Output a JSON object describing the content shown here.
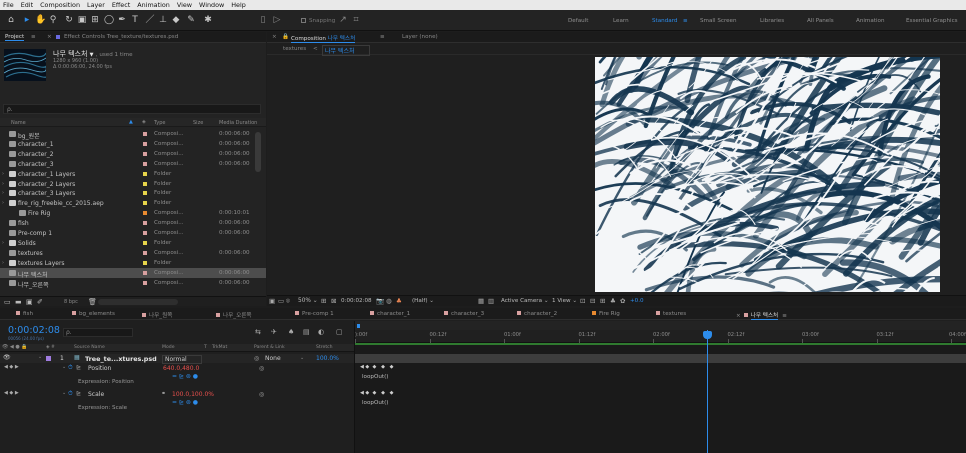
{
  "menubar": [
    "File",
    "Edit",
    "Composition",
    "Layer",
    "Effect",
    "Animation",
    "View",
    "Window",
    "Help"
  ],
  "toolbar": {
    "snapping": "Snapping",
    "workspaces": [
      "Default",
      "Learn",
      "Standard",
      "Small Screen",
      "Libraries",
      "All Panels",
      "Animation",
      "Essential Graphics"
    ],
    "active_workspace": "Standard"
  },
  "project": {
    "tab": "Project",
    "tab2": "Effect Controls Tree_texture/textures.psd",
    "comp_name": "나무 텍스처",
    "used": ", used 1 time",
    "size": "1280 x 960 (1.00)",
    "duration": "Δ 0:00:06:00, 24.00 fps",
    "search_placeholder": "ρ.",
    "columns": {
      "name": "Name",
      "type": "Type",
      "size": "Size",
      "media_duration": "Media Duration"
    },
    "items": [
      {
        "name": "bg_원본",
        "type": "Composi...",
        "duration": "0:00:06:00",
        "kind": "comp",
        "color": "#d8a0a0"
      },
      {
        "name": "character_1",
        "type": "Composi...",
        "duration": "0:00:06:00",
        "kind": "comp",
        "color": "#d8a0a0"
      },
      {
        "name": "character_2",
        "type": "Composi...",
        "duration": "0:00:06:00",
        "kind": "comp",
        "color": "#d8a0a0"
      },
      {
        "name": "character_3",
        "type": "Composi...",
        "duration": "0:00:06:00",
        "kind": "comp",
        "color": "#d8a0a0"
      },
      {
        "name": "character_1 Layers",
        "type": "Folder",
        "duration": "",
        "kind": "folder",
        "color": "#e6d44a"
      },
      {
        "name": "character_2 Layers",
        "type": "Folder",
        "duration": "",
        "kind": "folder",
        "color": "#e6d44a"
      },
      {
        "name": "character_3 Layers",
        "type": "Folder",
        "duration": "",
        "kind": "folder",
        "color": "#e6d44a"
      },
      {
        "name": "fire_rig_freebie_cc_2015.aep",
        "type": "Folder",
        "duration": "",
        "kind": "folder",
        "color": "#e6d44a"
      },
      {
        "name": "Fire Rig",
        "type": "Composi...",
        "duration": "0:00:10:01",
        "kind": "comp",
        "color": "#e88a30"
      },
      {
        "name": "fish",
        "type": "Composi...",
        "duration": "0:00:06:00",
        "kind": "comp",
        "color": "#d8a0a0"
      },
      {
        "name": "Pre-comp 1",
        "type": "Composi...",
        "duration": "0:00:06:00",
        "kind": "comp",
        "color": "#d8a0a0"
      },
      {
        "name": "Solids",
        "type": "Folder",
        "duration": "",
        "kind": "folder",
        "color": "#e6d44a"
      },
      {
        "name": "textures",
        "type": "Composi...",
        "duration": "0:00:06:00",
        "kind": "comp",
        "color": "#d8a0a0"
      },
      {
        "name": "textures Layers",
        "type": "Folder",
        "duration": "",
        "kind": "folder",
        "color": "#e6d44a"
      },
      {
        "name": "나무 텍스처",
        "type": "Composi...",
        "duration": "0:00:06:00",
        "kind": "comp",
        "color": "#d8a0a0"
      },
      {
        "name": "나무_오른쪽",
        "type": "Composi...",
        "duration": "0:00:06:00",
        "kind": "comp",
        "color": "#d8a0a0"
      }
    ],
    "bpc": "8 bpc"
  },
  "composition": {
    "tab": "Composition 나무 텍스처",
    "tab_comp": "나무 텍스처",
    "layer_tab": "Layer (none)",
    "breadcrumb": [
      "textures",
      "나무 텍스처"
    ],
    "zoom": "50%",
    "timecode": "0:00:02:08",
    "resolution": "(Half)",
    "camera": "Active Camera",
    "views": "1 View",
    "exposure": "+0.0"
  },
  "timeline": {
    "tabs": [
      {
        "label": "fish",
        "color": "#d8a0a0"
      },
      {
        "label": "bg_elements",
        "color": "#d8a0a0"
      },
      {
        "label": "나무_원쪽",
        "color": "#d8a0a0"
      },
      {
        "label": "나무_오른쪽",
        "color": "#d8a0a0"
      },
      {
        "label": "Pre-comp 1",
        "color": "#d8a0a0"
      },
      {
        "label": "character_1",
        "color": "#d8a0a0"
      },
      {
        "label": "character_3",
        "color": "#d8a0a0"
      },
      {
        "label": "character_2",
        "color": "#d8a0a0"
      },
      {
        "label": "Fire Rig",
        "color": "#e88a30"
      },
      {
        "label": "textures",
        "color": "#d8a0a0"
      },
      {
        "label": "나무 텍스처",
        "color": "#d8a0a0"
      }
    ],
    "timecode": "0:00:02:08",
    "timecode_sub": "00056 (24.00 fps)",
    "search_placeholder": "ρ.",
    "columns": {
      "source": "Source Name",
      "mode": "Mode",
      "t": "T",
      "trkmat": "TrkMat",
      "parent": "Parent & Link",
      "stretch": "Stretch"
    },
    "layer": {
      "index": "1",
      "name": "Tree_te...xtures.psd",
      "mode": "Normal",
      "parent": "None",
      "stretch": "100.0%"
    },
    "properties": [
      {
        "name": "Position",
        "value": "640.0,480.0",
        "expression_label": "Expression: Position",
        "expression": "loopOut()"
      },
      {
        "name": "Scale",
        "value": "100.0,100.0%",
        "expression_label": "Expression: Scale",
        "expression": "loopOut()"
      }
    ],
    "ruler": [
      "):00f",
      "00:12f",
      "01:00f",
      "01:12f",
      "02:00f",
      "02:12f",
      "03:00f",
      "03:12f",
      "04:00f"
    ]
  }
}
